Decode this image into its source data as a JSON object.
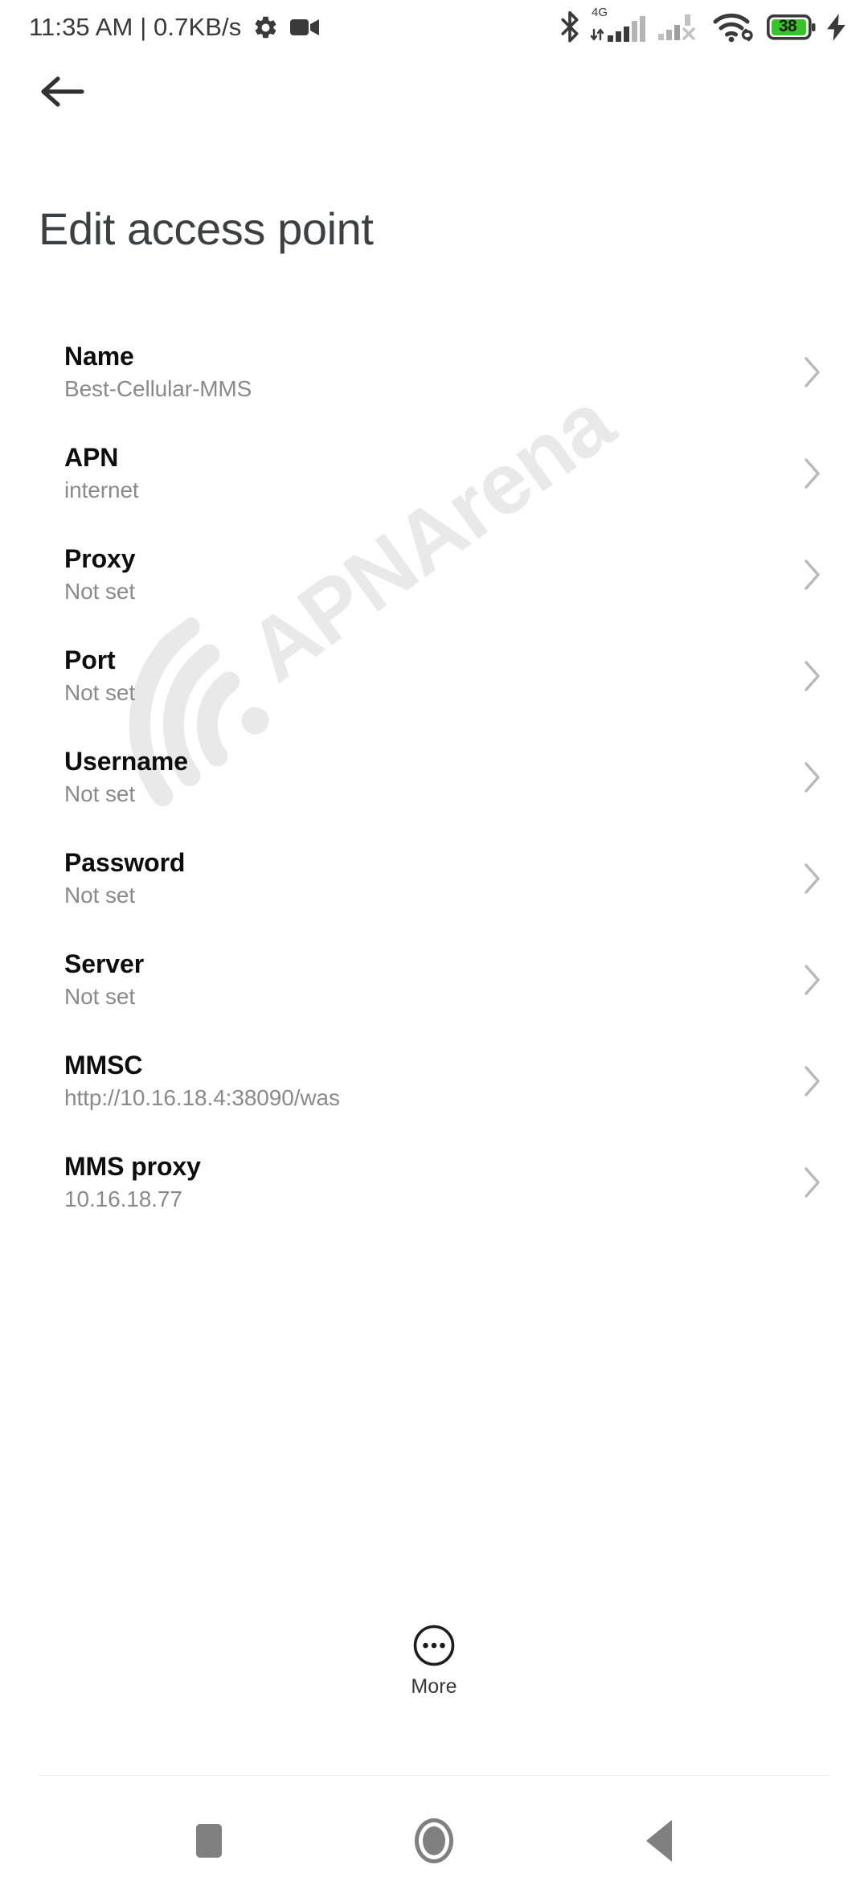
{
  "status_bar": {
    "clock_text": "11:35 AM | 0.7KB/s",
    "left_icons": [
      "gear-icon",
      "video-camera-icon"
    ],
    "right_icons": [
      "bluetooth-icon",
      "signal-4g-icon",
      "signal-sim2-off-icon",
      "wifi-icon",
      "battery-icon",
      "charging-bolt-icon"
    ],
    "network_type": "4G",
    "battery_percent": "38",
    "battery_color": "#37c428"
  },
  "header": {
    "back_icon": "arrow-left-icon",
    "title": "Edit access point"
  },
  "settings": {
    "rows": [
      {
        "title": "Name",
        "value": "Best-Cellular-MMS"
      },
      {
        "title": "APN",
        "value": "internet"
      },
      {
        "title": "Proxy",
        "value": "Not set"
      },
      {
        "title": "Port",
        "value": "Not set"
      },
      {
        "title": "Username",
        "value": "Not set"
      },
      {
        "title": "Password",
        "value": "Not set"
      },
      {
        "title": "Server",
        "value": "Not set"
      },
      {
        "title": "MMSC",
        "value": "http://10.16.18.4:38090/was"
      },
      {
        "title": "MMS proxy",
        "value": "10.16.18.77"
      }
    ]
  },
  "more_button": {
    "label": "More",
    "icon": "more-circle-icon"
  },
  "watermark": {
    "text": "APNArena",
    "color": "#e9e9e9"
  },
  "nav_bar": {
    "recents_label": "recents-square-icon",
    "home_label": "home-circle-icon",
    "back_label": "back-triangle-icon"
  }
}
